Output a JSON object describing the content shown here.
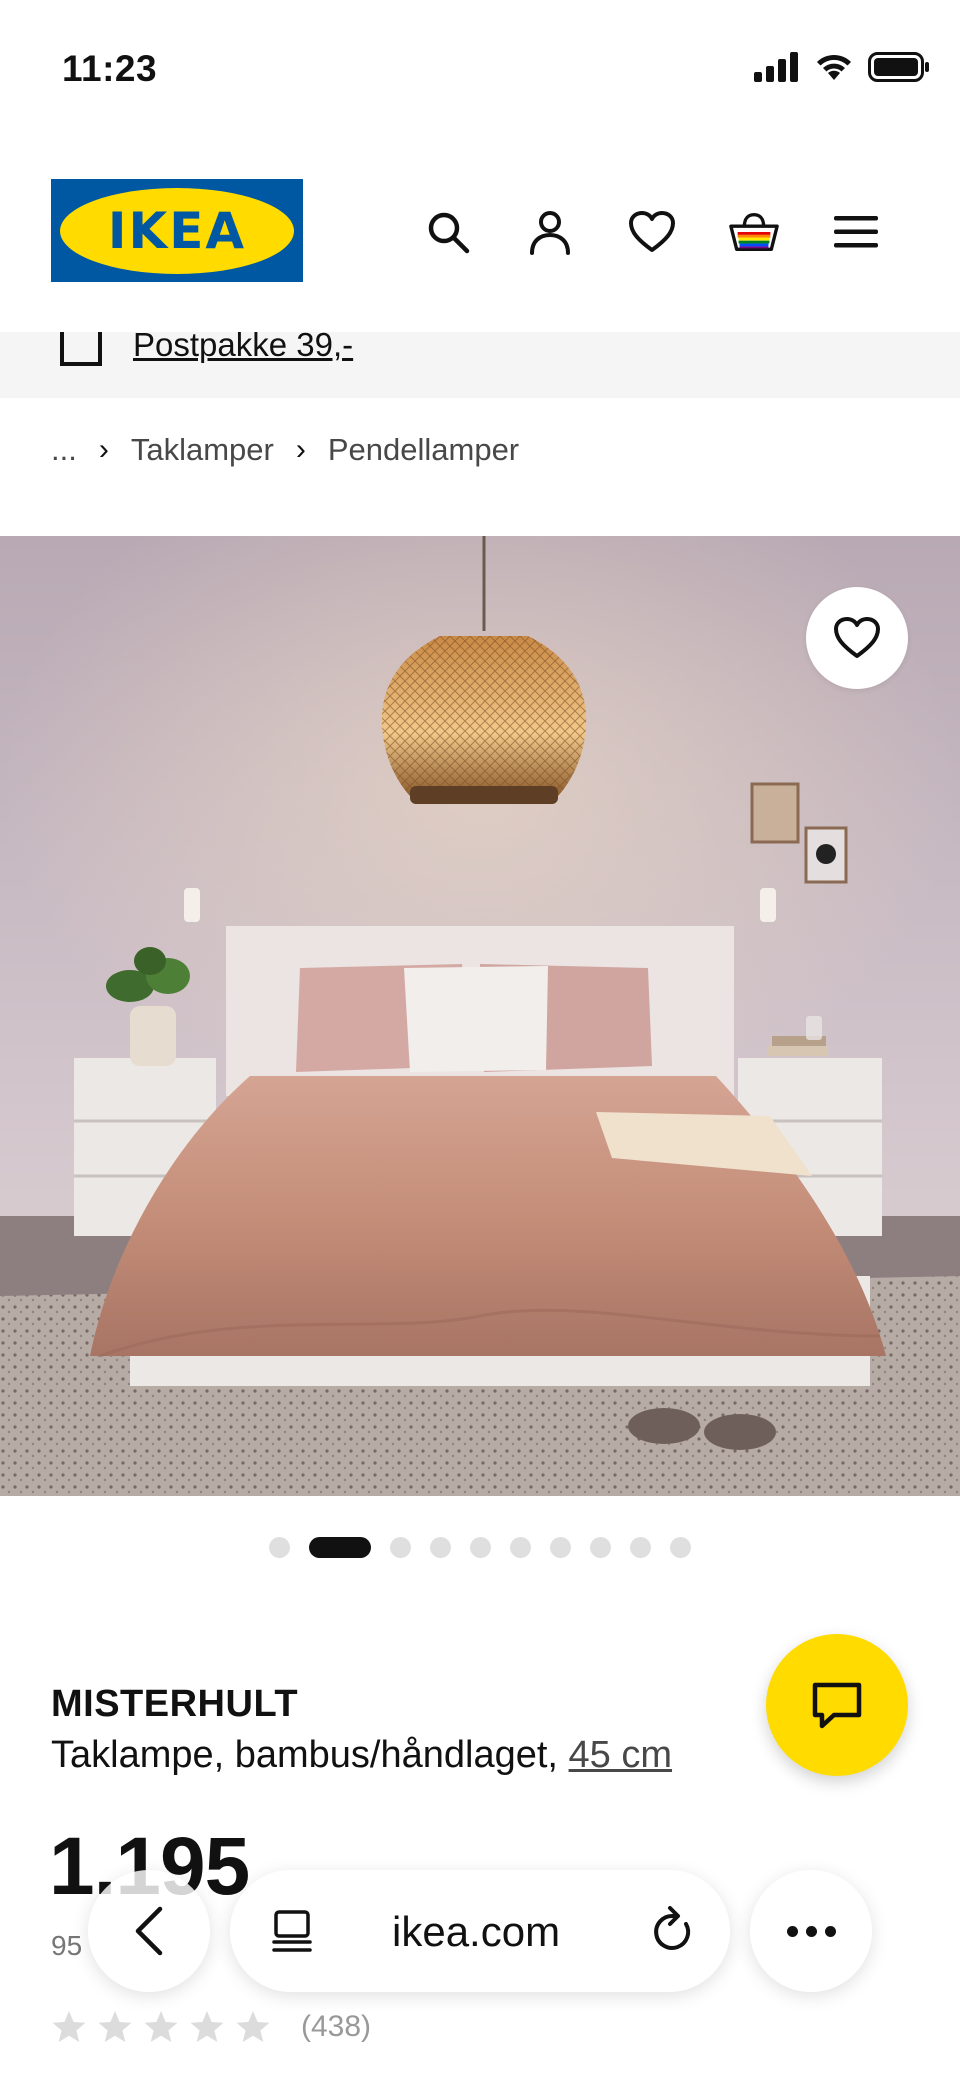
{
  "status_bar": {
    "time": "11:23"
  },
  "header": {
    "logo_text": "IKEA",
    "icons": [
      "search-icon",
      "user-icon",
      "heart-icon",
      "cart-icon",
      "menu-icon"
    ]
  },
  "delivery": {
    "text": "Postpakke 39,-"
  },
  "breadcrumb": {
    "ellipsis": "...",
    "separator": "›",
    "items": [
      "Taklamper",
      "Pendellamper"
    ]
  },
  "gallery": {
    "dot_count": 10,
    "active_index": 1
  },
  "product": {
    "name": "MISTERHULT",
    "description": "Taklampe, bambus/håndlaget, ",
    "size": "45 cm",
    "price": "1.195",
    "price_sub": "95",
    "rating_stars": 5,
    "rating_value": 0,
    "review_count": "(438)"
  },
  "browser": {
    "url": "ikea.com"
  },
  "colors": {
    "ikea_blue": "#0058a3",
    "ikea_yellow": "#ffdb00",
    "text": "#111111",
    "muted": "#767676"
  }
}
